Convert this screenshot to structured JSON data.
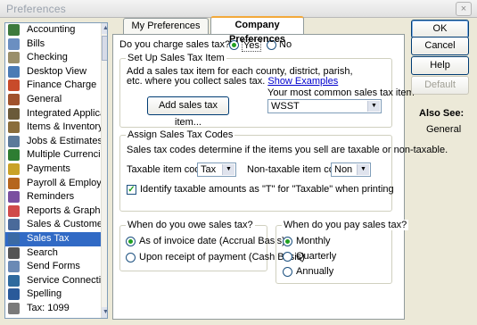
{
  "window": {
    "title": "Preferences",
    "close_label": "×"
  },
  "sidebar": {
    "items": [
      {
        "label": "Accounting",
        "icon": "accounting-icon",
        "color": "#3d7a3d"
      },
      {
        "label": "Bills",
        "icon": "bills-icon",
        "color": "#6b8fc1"
      },
      {
        "label": "Checking",
        "icon": "checking-icon",
        "color": "#9a8f6a"
      },
      {
        "label": "Desktop View",
        "icon": "desktop-view-icon",
        "color": "#4a7bb5"
      },
      {
        "label": "Finance Charge",
        "icon": "finance-charge-icon",
        "color": "#c84b2a"
      },
      {
        "label": "General",
        "icon": "general-icon",
        "color": "#a0522d"
      },
      {
        "label": "Integrated Applicatio",
        "icon": "integrated-applications-icon",
        "color": "#6a5a3a"
      },
      {
        "label": "Items & Inventory",
        "icon": "items-inventory-icon",
        "color": "#8a6d3b"
      },
      {
        "label": "Jobs & Estimates",
        "icon": "jobs-estimates-icon",
        "color": "#5c7a9a"
      },
      {
        "label": "Multiple Currencies",
        "icon": "multiple-currencies-icon",
        "color": "#2e7d32"
      },
      {
        "label": "Payments",
        "icon": "payments-icon",
        "color": "#c9a227"
      },
      {
        "label": "Payroll & Employees",
        "icon": "payroll-employees-icon",
        "color": "#b5651d"
      },
      {
        "label": "Reminders",
        "icon": "reminders-icon",
        "color": "#7a4fa0"
      },
      {
        "label": "Reports & Graphs",
        "icon": "reports-graphs-icon",
        "color": "#d04a4a"
      },
      {
        "label": "Sales & Customers",
        "icon": "sales-customers-icon",
        "color": "#4a6a9a"
      },
      {
        "label": "Sales Tax",
        "icon": "sales-tax-icon",
        "color": "#3a6aa5"
      },
      {
        "label": "Search",
        "icon": "search-icon",
        "color": "#555555"
      },
      {
        "label": "Send Forms",
        "icon": "send-forms-icon",
        "color": "#6a8ab5"
      },
      {
        "label": "Service Connection",
        "icon": "service-connection-icon",
        "color": "#2e6a9e"
      },
      {
        "label": "Spelling",
        "icon": "spelling-icon",
        "color": "#2a5a9a"
      },
      {
        "label": "Tax: 1099",
        "icon": "tax-1099-icon",
        "color": "#7a7a7a"
      }
    ]
  },
  "tabs": {
    "my": "My Preferences",
    "company": "Company Preferences"
  },
  "charge": {
    "question": "Do you charge sales tax?",
    "yes": "Yes",
    "no": "No"
  },
  "setup": {
    "title": "Set Up Sales Tax Item",
    "desc": "Add a sales tax item for each county, district, parish, etc. where you collect sales tax.",
    "link": "Show Examples",
    "add_button": "Add sales tax item...",
    "common_label": "Your most common sales tax item",
    "common_value": "WSST"
  },
  "assign": {
    "title": "Assign Sales Tax Codes",
    "desc": "Sales tax codes determine if the items you sell are taxable or non-taxable.",
    "taxable_label": "Taxable item code",
    "taxable_value": "Tax",
    "nontaxable_label": "Non-taxable item code",
    "nontaxable_value": "Non",
    "identify_label": "Identify taxable amounts as \"T\" for \"Taxable\" when printing"
  },
  "owe": {
    "title": "When do you owe sales tax?",
    "opt1": "As of invoice date (Accrual Basis)",
    "opt2": "Upon receipt of payment (Cash Basis)"
  },
  "pay": {
    "title": "When do you pay sales tax?",
    "opt1": "Monthly",
    "opt2": "Quarterly",
    "opt3": "Annually"
  },
  "buttons": {
    "ok": "OK",
    "cancel": "Cancel",
    "help": "Help",
    "default": "Default"
  },
  "also_see": {
    "title": "Also See:",
    "item": "General"
  }
}
